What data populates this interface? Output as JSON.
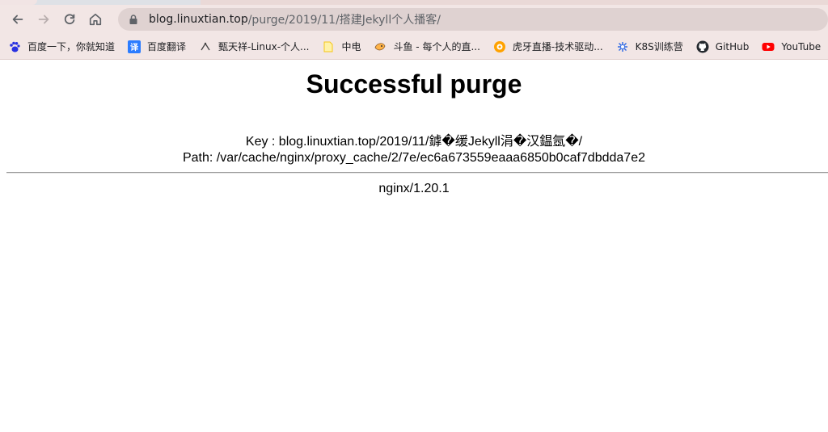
{
  "browser": {
    "url_host": "blog.linuxtian.top",
    "url_path": "/purge/2019/11/搭建Jekyll个人播客/"
  },
  "bookmarks": [
    {
      "label": "百度一下，你就知道",
      "icon": "baidu-paw-icon",
      "color": "#2932e1"
    },
    {
      "label": "百度翻译",
      "icon": "translate-icon",
      "color": "#2b7cff"
    },
    {
      "label": "甄天祥-Linux-个人...",
      "icon": "blog-favicon-icon",
      "color": "#555555"
    },
    {
      "label": "中电",
      "icon": "folder-icon",
      "color": "#f5c518"
    },
    {
      "label": "斗鱼 - 每个人的直...",
      "icon": "douyu-icon",
      "color": "#ff7700"
    },
    {
      "label": "虎牙直播-技术驱动...",
      "icon": "huya-icon",
      "color": "#ffa200"
    },
    {
      "label": "K8S训练营",
      "icon": "k8s-icon",
      "color": "#326ce5"
    },
    {
      "label": "GitHub",
      "icon": "github-icon",
      "color": "#24292e"
    },
    {
      "label": "YouTube",
      "icon": "youtube-icon",
      "color": "#ff0000"
    }
  ],
  "page": {
    "title": "Successful purge",
    "key_line": "Key : blog.linuxtian.top/2019/11/鎼�缓Jekyll涓�汉鎾氬�/",
    "path_line": "Path: /var/cache/nginx/proxy_cache/2/7e/ec6a673559eaaa6850b0caf7dbdda7e2",
    "server": "nginx/1.20.1"
  }
}
